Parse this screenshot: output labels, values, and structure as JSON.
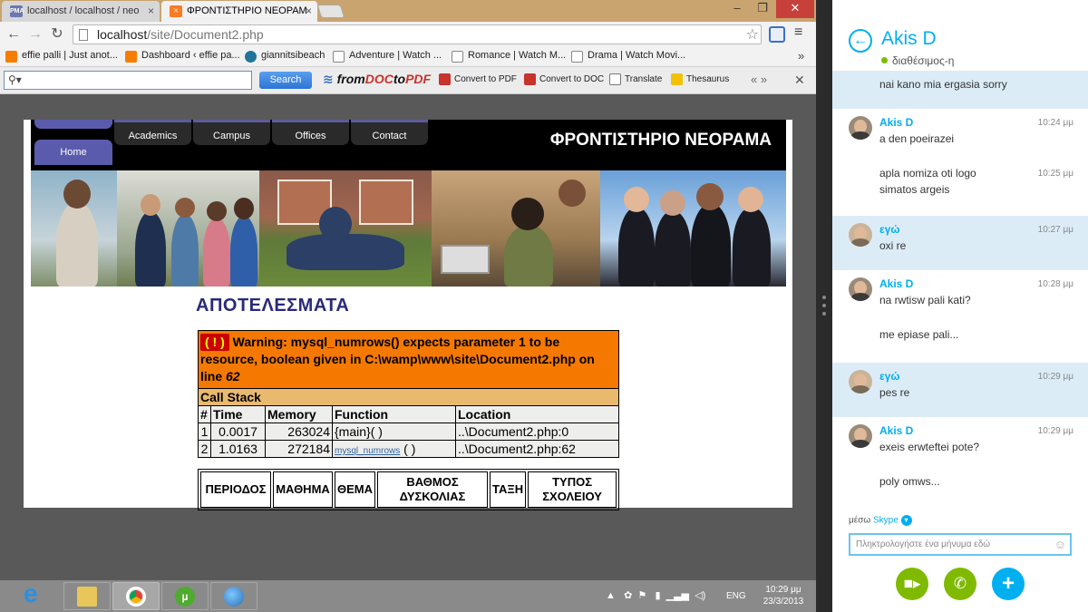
{
  "browser": {
    "tabs": [
      {
        "title": "localhost / localhost / neo",
        "icon": "phpmyadmin-icon"
      },
      {
        "title": "ΦΡΟΝΤΙΣΤΗΡΙΟ ΝΕΟΡΑΜ",
        "icon": "xampp-icon"
      }
    ],
    "url_host": "localhost",
    "url_path": "/site/Document2.php",
    "bookmarks": [
      {
        "label": "effie palli | Just anot...",
        "icon": "blogger-icon",
        "color": "#f57d00"
      },
      {
        "label": "Dashboard ‹ effie pa...",
        "icon": "blogger-icon",
        "color": "#f57d00"
      },
      {
        "label": "giannitsibeach",
        "icon": "wordpress-icon",
        "color": "#21759b"
      },
      {
        "label": "Adventure | Watch ...",
        "icon": "page-icon",
        "color": "#ffffff"
      },
      {
        "label": "Romance | Watch M...",
        "icon": "page-icon",
        "color": "#ffffff"
      },
      {
        "label": "Drama | Watch Movi...",
        "icon": "page-icon",
        "color": "#ffffff"
      }
    ],
    "more_bookmarks": "»"
  },
  "toolbar2": {
    "search_value": "",
    "search_button": "Search",
    "brand_from": "from",
    "brand_doc": "DOC",
    "brand_to": "to",
    "brand_pdf": "PDF",
    "items": [
      "Convert to PDF",
      "Convert to DOC",
      "Translate",
      "Thesaurus"
    ]
  },
  "site": {
    "title": "ΦΡΟΝΤΙΣΤΗΡΙΟ ΝΕΟΡΑΜΑ",
    "nav": [
      "Home",
      "Academics",
      "Campus",
      "Offices",
      "Contact"
    ],
    "results_heading": "ΑΠΟΤΕΛΕΣΜΑΤΑ"
  },
  "error": {
    "bang": "( ! )",
    "message_pre": " Warning: mysql_numrows() expects parameter 1 to be resource, boolean given in C:\\wamp\\www\\site\\Document2.php on line ",
    "line": "62",
    "call_stack_label": "Call Stack",
    "columns": [
      "#",
      "Time",
      "Memory",
      "Function",
      "Location"
    ],
    "rows": [
      {
        "n": "1",
        "time": "0.0017",
        "memory": "263024",
        "function": "{main}( )",
        "function_link": "",
        "function_suffix": "",
        "location": "..\\Document2.php:0"
      },
      {
        "n": "2",
        "time": "1.0163",
        "memory": "272184",
        "function": "",
        "function_link": "mysql_numrows",
        "function_suffix": " ( )",
        "location": "..\\Document2.php:62"
      }
    ]
  },
  "results_table": {
    "columns": [
      "ΠΕΡΙΟΔΟΣ",
      "ΜΑΘΗΜΑ",
      "ΘΕΜΑ",
      "ΒΑΘΜΟΣ ΔΥΣΚΟΛΙΑΣ",
      "ΤΑΞΗ",
      "ΤΥΠΟΣ ΣΧΟΛΕΙΟΥ"
    ]
  },
  "skype": {
    "contact": "Akis D",
    "status": "διαθέσιμος-η",
    "messages": [
      {
        "sender": "",
        "time": "",
        "text": "nai kano mia ergasia sorry",
        "mine": true,
        "avatar": false
      },
      {
        "sender": "Akis D",
        "time": "10:24 μμ",
        "text": "a den poeirazei",
        "mine": false,
        "avatar": true
      },
      {
        "sender": "",
        "time": "10:25 μμ",
        "text": "apla nomiza oti logo simatos argeis",
        "mine": false,
        "avatar": false
      },
      {
        "sender": "εγώ",
        "time": "10:27 μμ",
        "text": "oxi re",
        "mine": true,
        "avatar": true
      },
      {
        "sender": "Akis D",
        "time": "10:28 μμ",
        "text": "na rwtisw pali kati?",
        "mine": false,
        "avatar": true
      },
      {
        "sender": "",
        "time": "",
        "text": "me epiase pali...",
        "mine": false,
        "avatar": false
      },
      {
        "sender": "εγώ",
        "time": "10:29 μμ",
        "text": "pes re",
        "mine": true,
        "avatar": true
      },
      {
        "sender": "Akis D",
        "time": "10:29 μμ",
        "text": "exeis erwteftei pote?",
        "mine": false,
        "avatar": true
      },
      {
        "sender": "",
        "time": "",
        "text": "poly omws...",
        "mine": false,
        "avatar": false
      }
    ],
    "via_label": "μέσω",
    "via_service": "Skype",
    "input_placeholder": "Πληκτρολογήστε ένα μήνυμα εδώ",
    "colors": {
      "accent": "#00aff0",
      "call_green": "#7fba00",
      "add_blue": "#00aff0"
    }
  },
  "taskbar": {
    "lang": "ENG",
    "time": "10:29 μμ",
    "date": "23/3/2013",
    "apps": [
      "internet-explorer-icon",
      "file-explorer-icon",
      "chrome-icon",
      "utorrent-icon",
      "network-people-icon"
    ]
  }
}
